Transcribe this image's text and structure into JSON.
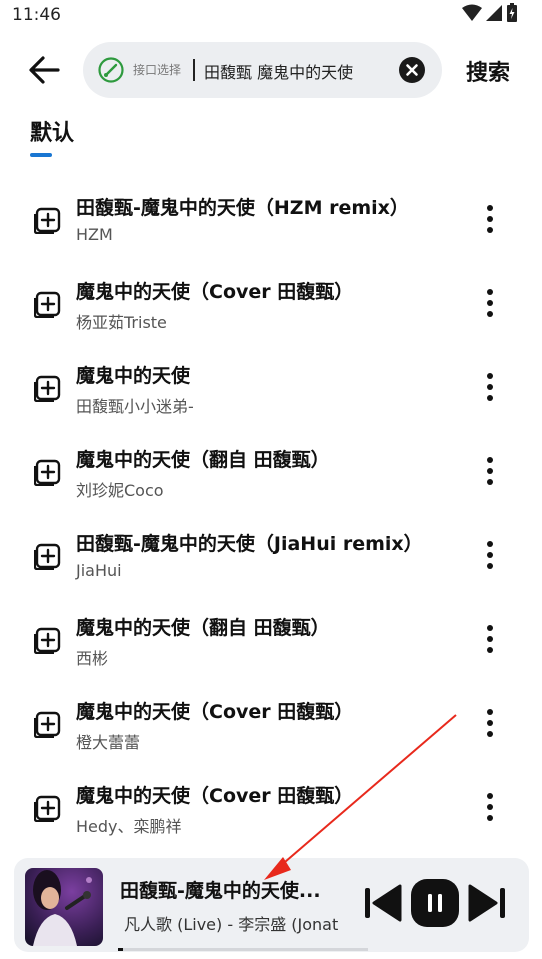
{
  "status_bar": {
    "time": "11:46",
    "icons": [
      "wifi-icon",
      "signal-icon",
      "battery-icon"
    ]
  },
  "header": {
    "interface_label": "接口选择",
    "search_value": "田馥甄 魔鬼中的天使",
    "search_button": "搜索"
  },
  "tabs": {
    "default_label": "默认"
  },
  "songs": [
    {
      "title": "田馥甄-魔鬼中的天使（HZM remix）",
      "artist": "HZM"
    },
    {
      "title": "魔鬼中的天使（Cover 田馥甄）",
      "artist": "杨亚茹Triste"
    },
    {
      "title": "魔鬼中的天使",
      "artist": "田馥甄小小迷弟-"
    },
    {
      "title": "魔鬼中的天使（翻自 田馥甄）",
      "artist": "刘珍妮Coco"
    },
    {
      "title": "田馥甄-魔鬼中的天使（JiaHui remix）",
      "artist": "JiaHui"
    },
    {
      "title": "魔鬼中的天使（翻自 田馥甄）",
      "artist": "西彬"
    },
    {
      "title": "魔鬼中的天使（Cover 田馥甄）",
      "artist": "橙大蕾蕾"
    },
    {
      "title": "魔鬼中的天使（Cover 田馥甄）",
      "artist": "Hedy、栾鹏祥"
    }
  ],
  "now_playing": {
    "title": "田馥甄-魔鬼中的天使...",
    "subtitle": "凡人歌 (Live) - 李宗盛 (Jonat",
    "progress": 0.02
  },
  "colors": {
    "accent": "#1976d2",
    "annotation_arrow": "#e8291c",
    "interface_icon": "#2e9a3e",
    "search_bg": "#eceef1",
    "player_bg": "#eef0f3"
  }
}
